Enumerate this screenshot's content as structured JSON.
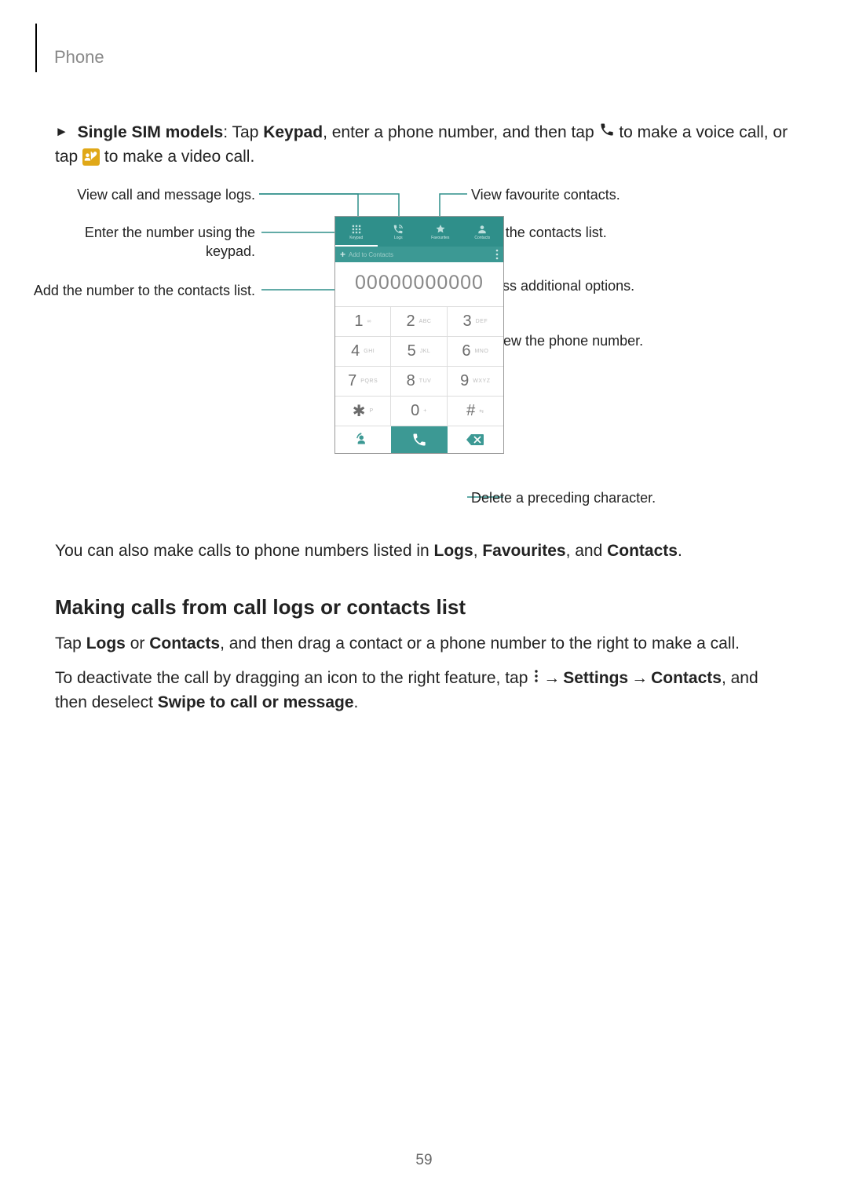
{
  "header": {
    "section": "Phone"
  },
  "intro": {
    "prefix_bold": "Single SIM models",
    "part1": ": Tap ",
    "bold_keypad": "Keypad",
    "part2": ", enter a phone number, and then tap ",
    "part3": " to make a voice call, or tap ",
    "part4": " to make a video call."
  },
  "callouts": {
    "logs": "View call and message logs.",
    "keypad": "Enter the number using the keypad.",
    "addcontact": "Add the number to the contacts list.",
    "favourites": "View favourite contacts.",
    "contacts": "View the contacts list.",
    "options": "Access additional options.",
    "preview": "Preview the phone number.",
    "delete": "Delete a preceding character."
  },
  "mock": {
    "tabs": {
      "keypad": "Keypad",
      "logs": "Logs",
      "favourites": "Favourites",
      "contacts": "Contacts"
    },
    "add_to_contacts": "Add to Contacts",
    "number": "00000000000",
    "keys": [
      {
        "d": "1",
        "s": "∞"
      },
      {
        "d": "2",
        "s": "ABC"
      },
      {
        "d": "3",
        "s": "DEF"
      },
      {
        "d": "4",
        "s": "GHI"
      },
      {
        "d": "5",
        "s": "JKL"
      },
      {
        "d": "6",
        "s": "MNO"
      },
      {
        "d": "7",
        "s": "PQRS"
      },
      {
        "d": "8",
        "s": "TUV"
      },
      {
        "d": "9",
        "s": "WXYZ"
      },
      {
        "d": "✱",
        "s": "P"
      },
      {
        "d": "0",
        "s": "+"
      },
      {
        "d": "#",
        "s": "⇆"
      }
    ]
  },
  "after_diagram": {
    "p1a": "You can also make calls to phone numbers listed in ",
    "b1": "Logs",
    "sep1": ", ",
    "b2": "Favourites",
    "sep2": ", and ",
    "b3": "Contacts",
    "end": "."
  },
  "section2": {
    "heading": "Making calls from call logs or contacts list",
    "p1a": "Tap ",
    "b_logs": "Logs",
    "p1b": " or ",
    "b_contacts": "Contacts",
    "p1c": ", and then drag a contact or a phone number to the right to make a call.",
    "p2a": "To deactivate the call by dragging an icon to the right feature, tap ",
    "arrow1": "→",
    "b_settings": "Settings",
    "arrow2": "→",
    "b_contacts2": "Contacts",
    "p2b": ", and then deselect ",
    "b_swipe": "Swipe to call or message",
    "dot": "."
  },
  "page_number": "59"
}
